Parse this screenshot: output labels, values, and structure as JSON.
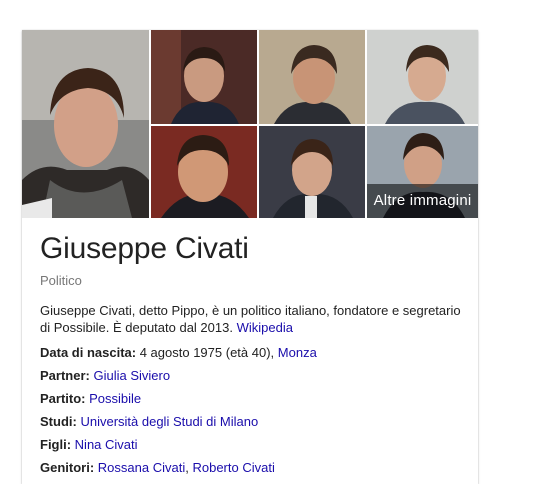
{
  "knowledge_panel": {
    "more_images_label": "Altre immagini",
    "name": "Giuseppe Civati",
    "type": "Politico",
    "description": "Giuseppe Civati, detto Pippo, è un politico italiano, fondatore e segretario di Possibile. È deputato dal 2013.",
    "source_link": "Wikipedia",
    "facts": {
      "birth_label": "Data di nascita:",
      "birth_value": "4 agosto 1975 (età 40),",
      "birth_place": "Monza",
      "partner_label": "Partner:",
      "partner_value": "Giulia Siviero",
      "party_label": "Partito:",
      "party_value": "Possibile",
      "studies_label": "Studi:",
      "studies_value": "Università degli Studi di Milano",
      "children_label": "Figli:",
      "children_value": "Nina Civati",
      "parents_label": "Genitori:",
      "parents_value_1": "Rossana Civati",
      "parents_value_2": "Roberto Civati"
    }
  },
  "colors": {
    "link": "#1a0dab",
    "text": "#222222",
    "subtle": "#777777"
  }
}
